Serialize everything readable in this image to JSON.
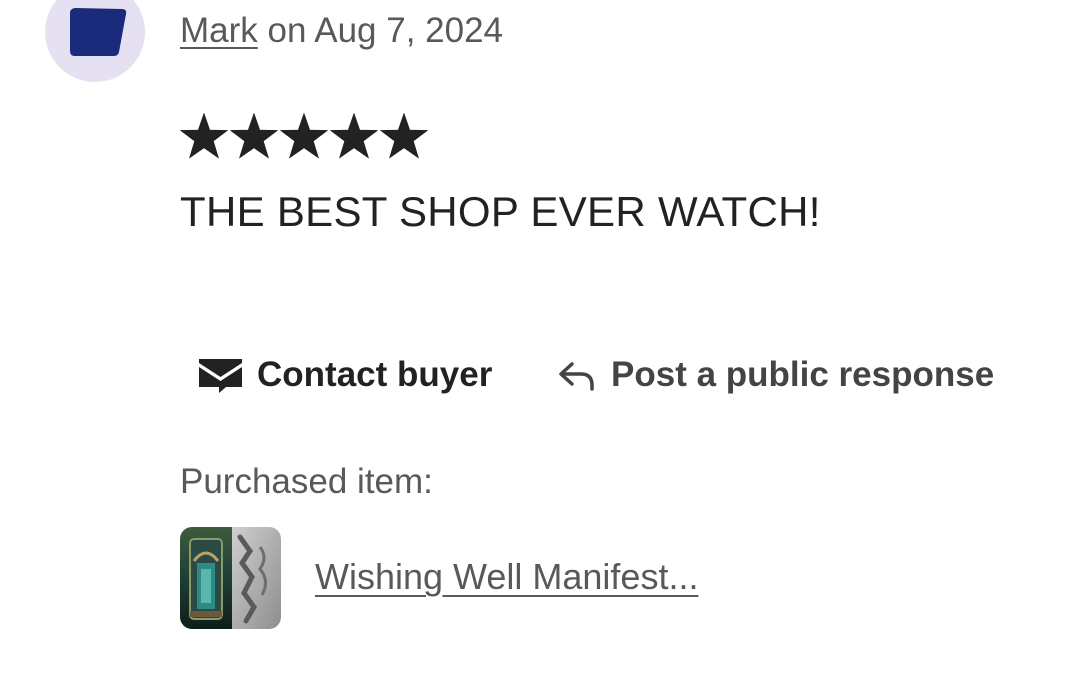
{
  "review": {
    "author": "Mark",
    "date_text": " on Aug 7, 2024",
    "rating": 5,
    "rating_max": 5,
    "text": "THE BEST SHOP EVER WATCH!"
  },
  "actions": {
    "contact_label": "Contact buyer",
    "contact_icon": "envelope-icon",
    "respond_label": "Post a public response",
    "respond_icon": "reply-arrow-icon"
  },
  "purchase": {
    "label": "Purchased item:",
    "item_title": "Wishing Well Manifest..."
  },
  "colors": {
    "avatar_bg": "#e6e1f2",
    "avatar_shape": "#1a2b7c",
    "text_dark": "#222222",
    "text_muted": "#595959"
  }
}
